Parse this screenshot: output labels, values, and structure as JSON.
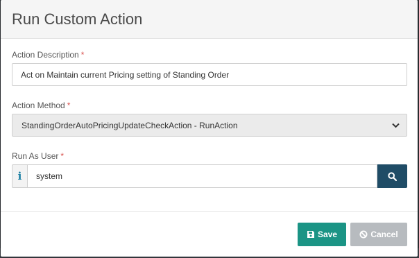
{
  "dialog": {
    "title": "Run Custom Action",
    "save_label": "Save",
    "cancel_label": "Cancel"
  },
  "fields": {
    "description": {
      "label": "Action Description",
      "required_mark": "*",
      "value": "Act on Maintain current Pricing setting of Standing Order"
    },
    "method": {
      "label": "Action Method",
      "required_mark": "*",
      "selected": "StandingOrderAutoPricingUpdateCheckAction - RunAction"
    },
    "user": {
      "label": "Run As User",
      "required_mark": "*",
      "addon": "i",
      "value": "system"
    }
  },
  "icons": {
    "save": "floppy-disk-icon",
    "cancel": "ban-icon",
    "search": "search-icon",
    "select": "chevron-down-icon",
    "info": "info-icon"
  },
  "colors": {
    "save": "#1b9485",
    "cancel": "#b7bbbf",
    "search": "#1f4c66",
    "required": "#d9534f"
  }
}
